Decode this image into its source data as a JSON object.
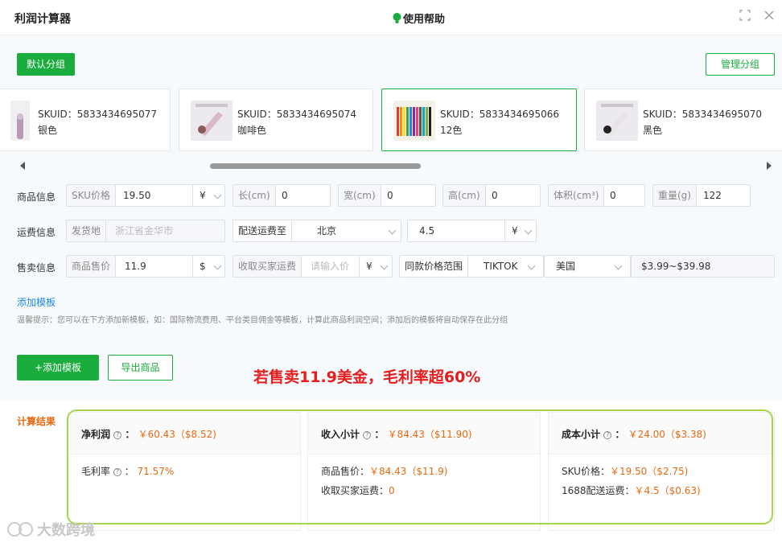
{
  "app": {
    "title": "利润计算器",
    "help": "使用帮助"
  },
  "toolbar": {
    "default_group": "默认分组",
    "manage_group": "管理分组"
  },
  "skus": [
    {
      "id": "SKUID：5833434695077",
      "color": "银色"
    },
    {
      "id": "SKUID：5833434695074",
      "color": "咖啡色"
    },
    {
      "id": "SKUID：5833434695066",
      "color": "12色"
    },
    {
      "id": "SKUID：5833434695070",
      "color": "黑色"
    }
  ],
  "product": {
    "label": "商品信息",
    "sku_price_label": "SKU价格",
    "sku_price": "19.50",
    "sku_currency": "¥",
    "length_label": "长(cm)",
    "length": "0",
    "width_label": "宽(cm)",
    "width": "0",
    "height_label": "高(cm)",
    "height": "0",
    "volume_label": "体积(cm³)",
    "volume": "0",
    "weight_label": "重量(g)",
    "weight": "122"
  },
  "shipping": {
    "label": "运费信息",
    "origin_label": "发货地",
    "origin": "浙江省金华市",
    "dest_label": "配送运费至",
    "dest": "北京",
    "fee": "4.5",
    "fee_currency": "¥"
  },
  "sales": {
    "label": "售卖信息",
    "price_label": "商品售价",
    "price": "11.9",
    "price_currency": "$",
    "buyer_fee_label": "收取买家运费",
    "buyer_fee_placeholder": "请输入价",
    "buyer_fee_currency": "¥",
    "range_label": "同款价格范围",
    "platform": "TIKTOK",
    "country": "美国",
    "range": "$3.99~$39.98"
  },
  "template": {
    "add_link": "添加模板",
    "tip": "温馨提示：您可以在下方添加新模板，如：国际物流费用、平台类目佣金等模板，计算此商品利润空间；添加后的模板将自动保存在此分组",
    "add_button": "+添加模板",
    "export_button": "导出商品"
  },
  "headline": "若售卖11.9美金，毛利率超60%",
  "result": {
    "label": "计算结果",
    "net_profit": {
      "title": "净利润",
      "value": "￥60.43（$8.52)",
      "margin_label": "毛利率",
      "margin": "71.57%"
    },
    "income": {
      "title": "收入小计",
      "value": "￥84.43（$11.90)",
      "l1_label": "商品售价：",
      "l1": "￥84.43（$11.9)",
      "l2_label": "收取买家运费：",
      "l2": "0"
    },
    "cost": {
      "title": "成本小计",
      "value": "￥24.00（$3.38)",
      "l1_label": "SKU价格：",
      "l1": "￥19.50（$2.75)",
      "l2_label": "1688配送运费：",
      "l2": "￥4.5（$0.63)"
    }
  },
  "watermark": "大数跨境",
  "colors": {
    "accent": "#1aad3e",
    "orange": "#e76a12",
    "red": "#e51d1d",
    "link": "#1e88e5"
  }
}
